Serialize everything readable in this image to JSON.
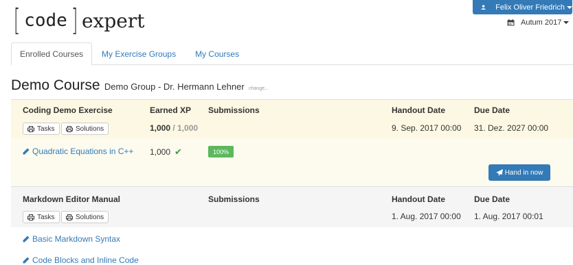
{
  "logo": {
    "part1": "code",
    "part2": "expert"
  },
  "user": {
    "name": "Felix Oliver Friedrich",
    "icon": "user-icon"
  },
  "semester": {
    "label": "Autum 2017",
    "icon": "calendar-icon"
  },
  "tabs": [
    {
      "label": "Enrolled Courses"
    },
    {
      "label": "My Exercise Groups"
    },
    {
      "label": "My Courses"
    }
  ],
  "course": {
    "name": "Demo Course",
    "group": "Demo Group - Dr. Hermann Lehner",
    "change": "change..."
  },
  "exercises": [
    {
      "title": "Coding Demo Exercise",
      "col_xp": "Earned XP",
      "col_submissions": "Submissions",
      "col_handout": "Handout Date",
      "col_due": "Due Date",
      "tasks_label": "Tasks",
      "solutions_label": "Solutions",
      "xp_earned": "1,000",
      "xp_total": " / 1,000",
      "handout": "9. Sep. 2017 00:00",
      "due": "31. Dez. 2027 00:00",
      "tasks": [
        {
          "label": "Quadratic Equations in C++",
          "xp": "1,000",
          "progress": "100%"
        }
      ],
      "hand_in_label": "Hand in now"
    },
    {
      "title": "Markdown Editor Manual",
      "col_submissions": "Submissions",
      "col_handout": "Handout Date",
      "col_due": "Due Date",
      "tasks_label": "Tasks",
      "solutions_label": "Solutions",
      "handout": "1. Aug. 2017 00:00",
      "due": "1. Aug. 2017 00:01",
      "tasks": [
        {
          "label": "Basic Markdown Syntax"
        },
        {
          "label": "Code Blocks and Inline Code"
        }
      ]
    }
  ],
  "colors": {
    "primary": "#337ab7",
    "success": "#5cb85c",
    "warning_bg": "#fcf8e3",
    "grey_bg": "#f5f5f5"
  }
}
